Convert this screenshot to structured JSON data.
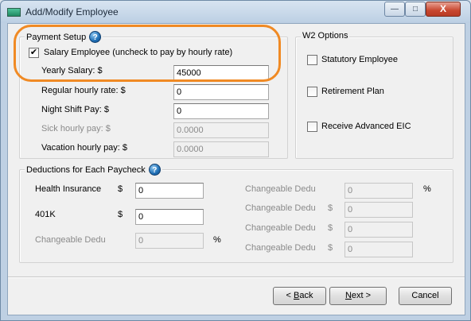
{
  "window": {
    "title": "Add/Modify Employee",
    "buttons": {
      "minimize": "—",
      "maximize": "□",
      "close": "X"
    }
  },
  "payment_setup": {
    "legend": "Payment Setup",
    "salary_checkbox_label": "Salary Employee (uncheck to pay by hourly rate)",
    "salary_checked": "✔",
    "yearly_salary": {
      "label": "Yearly Salary: $",
      "value": "45000"
    },
    "regular_hourly": {
      "label": "Regular hourly rate: $",
      "value": "0"
    },
    "night_shift": {
      "label": "Night Shift Pay: $",
      "value": "0"
    },
    "sick_hourly": {
      "label": "Sick hourly pay: $",
      "value": "0.0000"
    },
    "vacation_hourly": {
      "label": "Vacation hourly pay: $",
      "value": "0.0000"
    }
  },
  "w2_options": {
    "legend": "W2 Options",
    "statutory": "Statutory Employee",
    "retirement": "Retirement Plan",
    "advanced_eic": "Receive Advanced EIC"
  },
  "deductions": {
    "legend": "Deductions for Each Paycheck",
    "health": {
      "label": "Health Insurance",
      "currency": "$",
      "value": "0"
    },
    "k401": {
      "label": "401K",
      "currency": "$",
      "value": "0"
    },
    "changeable_left": {
      "label": "Changeable Dedu",
      "value": "0",
      "unit": "%"
    },
    "changeable_right": [
      {
        "label": "Changeable Dedu",
        "value": "0",
        "unit": "%"
      },
      {
        "label": "Changeable Dedu",
        "currency": "$",
        "value": "0"
      },
      {
        "label": "Changeable Dedu",
        "currency": "$",
        "value": "0"
      },
      {
        "label": "Changeable Dedu",
        "currency": "$",
        "value": "0"
      }
    ]
  },
  "footer": {
    "back_prefix": "< ",
    "back_key": "B",
    "back_rest": "ack",
    "next_key": "N",
    "next_rest": "ext >",
    "cancel": "Cancel"
  },
  "colors": {
    "highlight": "#f08a24"
  }
}
